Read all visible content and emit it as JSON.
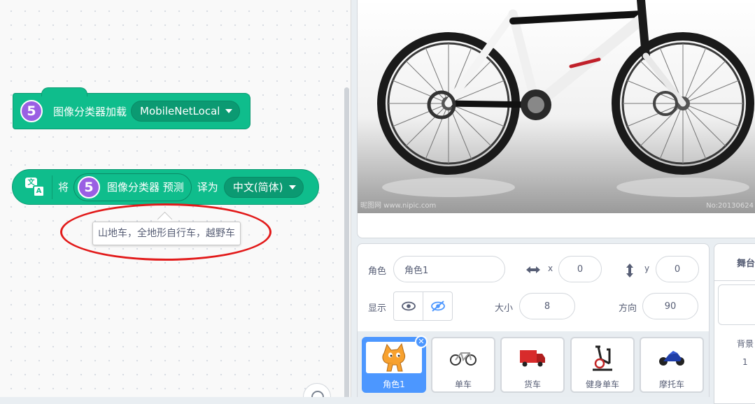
{
  "workspace": {
    "hat_block": {
      "icon_text": "5",
      "label": "图像分类器加载",
      "model": "MobileNetLocal"
    },
    "translate_block": {
      "prefix": "将",
      "inner_icon_text": "5",
      "inner_label": "图像分类器 预测",
      "middle": "译为",
      "language": "中文(简体)"
    },
    "tooltip": "山地车，全地形自行车，越野车"
  },
  "stage": {
    "watermark_left": "昵图网 www.nipic.com",
    "watermark_right": "No:20130624"
  },
  "sprite_info": {
    "sprite_label": "角色",
    "sprite_name": "角色1",
    "x_label": "x",
    "x_value": "0",
    "y_label": "y",
    "y_value": "0",
    "show_label": "显示",
    "size_label": "大小",
    "size_value": "8",
    "direction_label": "方向",
    "direction_value": "90"
  },
  "sprites": [
    {
      "name": "角色1",
      "icon": "cat-sprite-icon",
      "selected": true
    },
    {
      "name": "单车",
      "icon": "bicycle-icon"
    },
    {
      "name": "货车",
      "icon": "truck-icon"
    },
    {
      "name": "健身单车",
      "icon": "exercise-bike-icon"
    },
    {
      "name": "摩托车",
      "icon": "motorcycle-icon"
    }
  ],
  "stage_panel": {
    "title": "舞台",
    "backdrop_label": "背景",
    "backdrop_count": "1"
  },
  "colors": {
    "extension_green": "#0fbd8c",
    "extension_purple": "#9a5fe3",
    "selection_blue": "#4c97ff",
    "annotation_red": "#e21a1a"
  }
}
